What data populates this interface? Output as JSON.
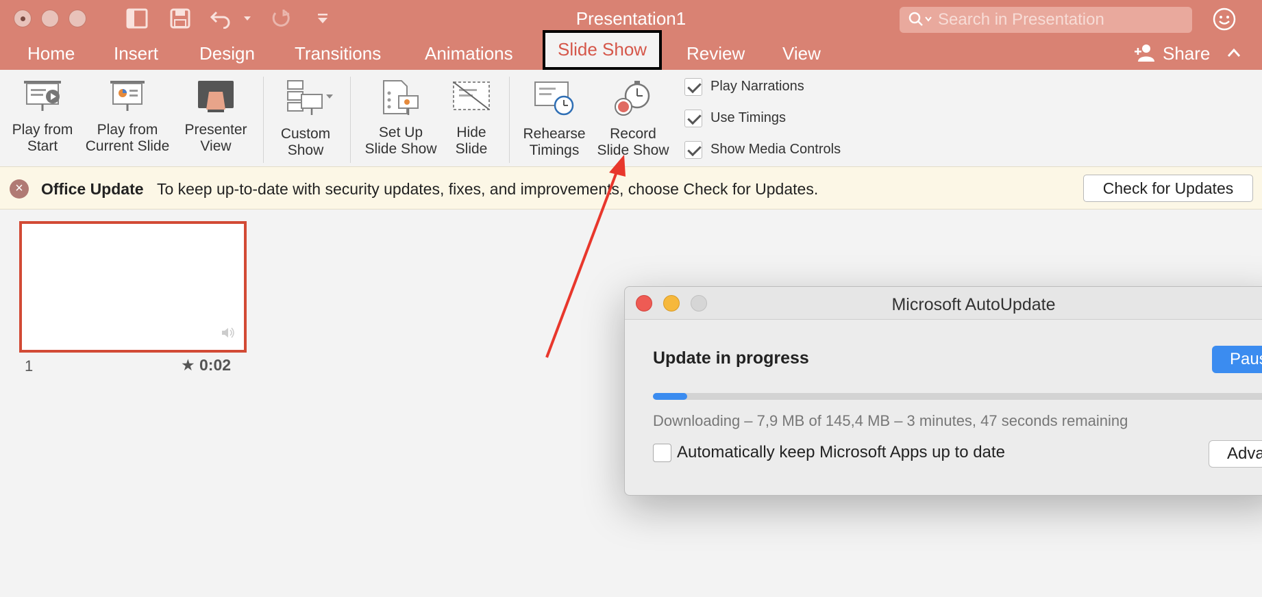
{
  "window": {
    "title": "Presentation1"
  },
  "search": {
    "placeholder": "Search in Presentation"
  },
  "tabs": [
    {
      "label": "Home"
    },
    {
      "label": "Insert"
    },
    {
      "label": "Design"
    },
    {
      "label": "Transitions"
    },
    {
      "label": "Animations"
    },
    {
      "label": "Slide Show"
    },
    {
      "label": "Review"
    },
    {
      "label": "View"
    }
  ],
  "share": {
    "label": "Share"
  },
  "ribbon": {
    "play_from_start": [
      "Play from",
      "Start"
    ],
    "play_from_current": [
      "Play from",
      "Current Slide"
    ],
    "presenter_view": [
      "Presenter",
      "View"
    ],
    "custom_show": [
      "Custom",
      "Show"
    ],
    "set_up": [
      "Set Up",
      "Slide Show"
    ],
    "hide_slide": [
      "Hide",
      "Slide"
    ],
    "rehearse": [
      "Rehearse",
      "Timings"
    ],
    "record": [
      "Record",
      "Slide Show"
    ],
    "checks": [
      {
        "label": "Play Narrations",
        "checked": true
      },
      {
        "label": "Use Timings",
        "checked": true
      },
      {
        "label": "Show Media Controls",
        "checked": true
      }
    ]
  },
  "update_bar": {
    "title": "Office Update",
    "message": "To keep up-to-date with security updates, fixes, and improvements, choose Check for Updates.",
    "button": "Check for Updates"
  },
  "slides": [
    {
      "number": "1",
      "time": "0:02"
    }
  ],
  "dialog": {
    "title": "Microsoft AutoUpdate",
    "heading": "Update in progress",
    "pause_button": "Paus",
    "progress_fraction": 0.054,
    "download_text": "Downloading – 7,9 MB of 145,4 MB – 3 minutes, 47 seconds remaining",
    "auto_update_label": "Automatically keep Microsoft Apps up to date",
    "advanced_button": "Adva"
  },
  "colors": {
    "titlebar": "#d98273",
    "accent": "#d5574a",
    "progress": "#3b8cf0",
    "arrow": "#e8372c"
  }
}
